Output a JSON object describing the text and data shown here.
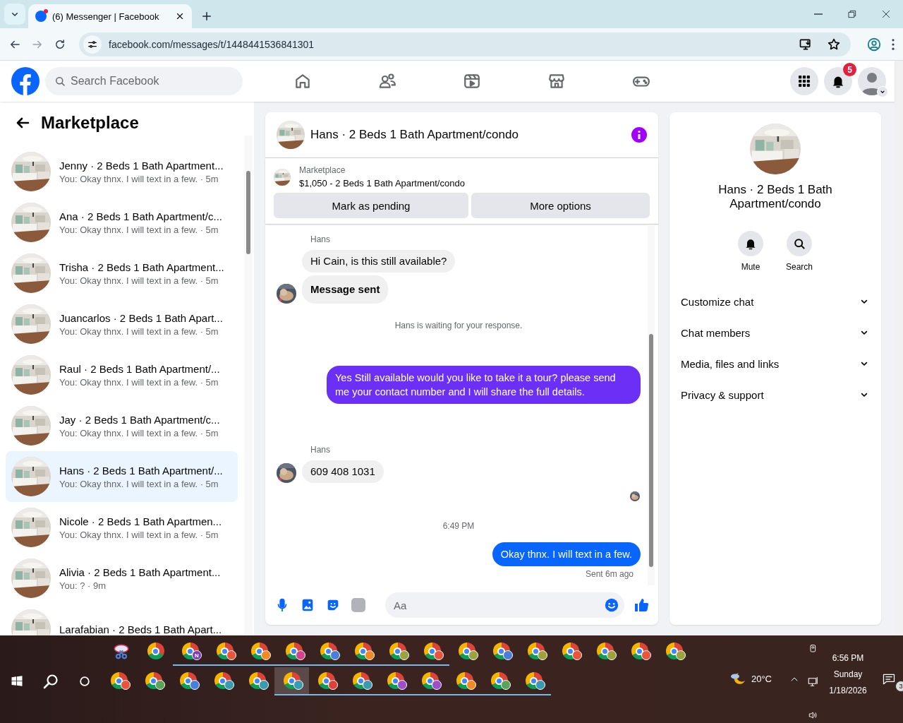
{
  "browser": {
    "tab": {
      "title": "(6) Messenger | Facebook",
      "notification_dot": true
    },
    "url": "facebook.com/messages/t/1448441536841301"
  },
  "header": {
    "search_placeholder": "Search Facebook",
    "nav": [
      {
        "kind": "home"
      },
      {
        "kind": "friends"
      },
      {
        "kind": "video"
      },
      {
        "kind": "marketplace"
      },
      {
        "kind": "gaming"
      }
    ],
    "notifications_badge": "5"
  },
  "sidebar": {
    "title": "Marketplace",
    "conversations": [
      {
        "title": "Jenny · 2 Beds 1 Bath Apartment...",
        "preview": "You: Okay thnx. I will text in a few. · 5m",
        "selected": false
      },
      {
        "title": "Ana · 2 Beds 1 Bath Apartment/c...",
        "preview": "You: Okay thnx. I will text in a few. · 5m",
        "selected": false
      },
      {
        "title": "Trisha · 2 Beds 1 Bath Apartment...",
        "preview": "You: Okay thnx. I will text in a few. · 5m",
        "selected": false
      },
      {
        "title": "Juancarlos · 2 Beds 1 Bath Apart...",
        "preview": "You: Okay thnx. I will text in a few. · 5m",
        "selected": false
      },
      {
        "title": "Raul · 2 Beds 1 Bath Apartment/...",
        "preview": "You: Okay thnx. I will text in a few. · 5m",
        "selected": false
      },
      {
        "title": "Jay · 2 Beds 1 Bath Apartment/c...",
        "preview": "You: Okay thnx. I will text in a few. · 5m",
        "selected": false
      },
      {
        "title": "Hans · 2 Beds 1 Bath Apartment/...",
        "preview": "You: Okay thnx. I will text in a few. · 5m",
        "selected": true
      },
      {
        "title": "Nicole · 2 Beds 1 Bath Apartmen...",
        "preview": "You: Okay thnx. I will text in a few. · 5m",
        "selected": false
      },
      {
        "title": "Alivia · 2 Beds 1 Bath Apartment...",
        "preview": "You: ? · 9m",
        "selected": false
      },
      {
        "title": "Larafabian · 2 Beds 1 Bath Apart...",
        "selected": false
      }
    ]
  },
  "chat": {
    "title": "Hans · 2 Beds 1 Bath Apartment/condo",
    "listing": {
      "source": "Marketplace",
      "summary": "$1,050 - 2 Beds 1 Bath Apartment/condo"
    },
    "actions": [
      "Mark as pending",
      "More options"
    ],
    "messages": [
      {
        "kind": "sender",
        "text": "Hans"
      },
      {
        "kind": "incoming",
        "text": "Hi Cain, is this still available?",
        "bold": false,
        "avatar": false
      },
      {
        "kind": "incoming",
        "text": "Message sent",
        "bold": true,
        "avatar": true
      },
      {
        "kind": "notice",
        "text": "Hans is waiting for your response."
      },
      {
        "kind": "outgoing",
        "text": "Yes Still available would you like to take it a tour? please send me your contact number and I will share the full details.",
        "color": "#6b2ff5"
      },
      {
        "kind": "sender",
        "text": "Hans"
      },
      {
        "kind": "incoming",
        "text": "609 408 1031",
        "bold": false,
        "avatar": true
      },
      {
        "kind": "seen"
      },
      {
        "kind": "time",
        "text": "6:49 PM"
      },
      {
        "kind": "outgoing",
        "text": "Okay thnx. I will text in a few.",
        "color": "#0866ff"
      },
      {
        "kind": "status",
        "text": "Sent 6m ago"
      }
    ],
    "composer": {
      "placeholder": "Aa"
    }
  },
  "details": {
    "name": "Hans · 2 Beds 1 Bath Apartment/condo",
    "actions": [
      {
        "kind": "mute",
        "label": "Mute"
      },
      {
        "kind": "search",
        "label": "Search"
      }
    ],
    "sections": [
      {
        "label": "Customize chat",
        "expanded": false
      },
      {
        "label": "Chat members",
        "expanded": false
      },
      {
        "label": "Media, files and links",
        "expanded": false
      },
      {
        "label": "Privacy & support",
        "expanded": false
      }
    ]
  },
  "taskbar": {
    "row1": [
      {
        "kind": "snip",
        "running": false
      },
      {
        "kind": "chrome",
        "running": false
      },
      {
        "kind": "chrome",
        "color": "#7b3fb5",
        "badge_text": "N",
        "running": true
      },
      {
        "kind": "chrome",
        "color": "#e8553d",
        "running": true
      },
      {
        "kind": "chrome",
        "color": "#f08a24",
        "running": true
      },
      {
        "kind": "chrome",
        "color": "#d6408f",
        "running": true
      },
      {
        "kind": "chrome",
        "color": "#4a7fd9",
        "running": true
      },
      {
        "kind": "chrome",
        "color": "#f08a24",
        "running": true
      },
      {
        "kind": "chrome",
        "color": "#9aa340",
        "running": true
      },
      {
        "kind": "chrome",
        "color": "#e8553d",
        "running": true
      },
      {
        "kind": "chrome",
        "color": "#9aa340",
        "running": false
      },
      {
        "kind": "chrome",
        "color": "#4a7fd9",
        "running": false
      },
      {
        "kind": "chrome",
        "color": "#9aa340",
        "running": false
      },
      {
        "kind": "chrome",
        "color": "#e8553d",
        "running": false
      },
      {
        "kind": "chrome",
        "color": "#9aa340",
        "running": false
      },
      {
        "kind": "chrome",
        "color": "#e8553d",
        "running": false
      },
      {
        "kind": "chrome",
        "color": "#9aa340",
        "running": false
      }
    ],
    "row2": [
      {
        "kind": "chrome",
        "color": "#e8553d",
        "running": false,
        "selected": false
      },
      {
        "kind": "chrome",
        "color": "#5aa35a",
        "running": false,
        "selected": false
      },
      {
        "kind": "chrome",
        "color": "#4a7fd9",
        "running": false,
        "selected": false
      },
      {
        "kind": "chrome",
        "color": "#3a9ab0",
        "running": false,
        "selected": false
      },
      {
        "kind": "chrome",
        "color": "#3a9ab0",
        "running": false,
        "selected": false
      },
      {
        "kind": "chrome",
        "color": "#3a9ab0",
        "running": true,
        "selected": true
      },
      {
        "kind": "chrome",
        "color": "#e0403a",
        "running": true,
        "selected": false
      },
      {
        "kind": "chrome",
        "color": "#3a9ab0",
        "running": true,
        "selected": false
      },
      {
        "kind": "chrome",
        "color": "#9b4fc8",
        "running": true,
        "selected": false
      },
      {
        "kind": "chrome",
        "color": "#9b4fc8",
        "running": true,
        "selected": false
      },
      {
        "kind": "chrome",
        "color": "#f08a24",
        "running": true,
        "selected": false
      },
      {
        "kind": "chrome",
        "color": "#5aa35a",
        "running": true,
        "selected": false
      },
      {
        "kind": "chrome",
        "color": "#3a9ab0",
        "running": true,
        "selected": false
      }
    ],
    "temperature": "20°C",
    "time": "6:56 PM",
    "day": "Sunday",
    "date": "1/18/2026",
    "notifications": "3"
  }
}
